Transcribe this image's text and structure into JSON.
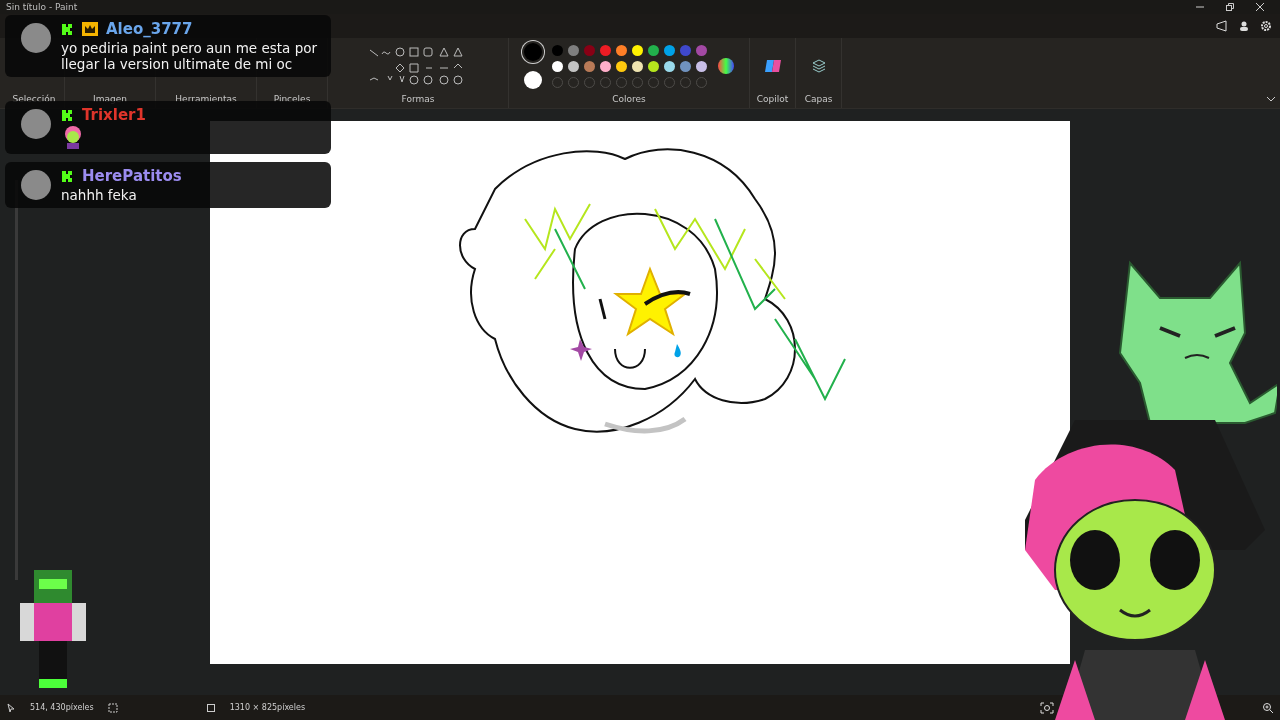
{
  "window": {
    "title": "Sin título - Paint"
  },
  "ribbon": {
    "groups": [
      "Selección",
      "Imagen",
      "Herramientas",
      "Pinceles",
      "Formas",
      "Colores",
      "Copilot",
      "Capas"
    ]
  },
  "current_colors": [
    {
      "color": "#000000",
      "selected": true
    },
    {
      "color": "#ffffff",
      "selected": false
    }
  ],
  "palette": [
    [
      {
        "color": "#000000"
      },
      {
        "color": "#7f7f7f"
      },
      {
        "color": "#880015"
      },
      {
        "color": "#ed1c24"
      },
      {
        "color": "#ff7f27"
      },
      {
        "color": "#fff200"
      },
      {
        "color": "#22b14c"
      },
      {
        "color": "#00a2e8"
      },
      {
        "color": "#3f48cc"
      },
      {
        "color": "#a349a4"
      }
    ],
    [
      {
        "color": "#ffffff"
      },
      {
        "color": "#c3c3c3"
      },
      {
        "color": "#b97a57"
      },
      {
        "color": "#ffaec9"
      },
      {
        "color": "#ffc90e"
      },
      {
        "color": "#efe4b0"
      },
      {
        "color": "#b5e61d"
      },
      {
        "color": "#99d9ea"
      },
      {
        "color": "#7092be"
      },
      {
        "color": "#c8bfe7"
      }
    ]
  ],
  "chat": [
    {
      "user": "Aleo_3777",
      "color": "#6aa6ec",
      "badges": [
        {
          "kind": "kick"
        },
        {
          "kind": "crown"
        }
      ],
      "kind": "text",
      "text": "yo pediria paint pero aun me esta por llegar la version ultimate de mi oc"
    },
    {
      "user": "Trixler1",
      "color": "#e0352b",
      "badges": [
        {
          "kind": "kick"
        }
      ],
      "kind": "emote"
    },
    {
      "user": "HerePatitos",
      "color": "#9b8cf0",
      "badges": [
        {
          "kind": "kick"
        }
      ],
      "kind": "text",
      "text": "nahhh feka"
    }
  ],
  "status_bar": {
    "cursor": "514, 430píxeles",
    "canvas_size": "1310 × 825píxeles"
  }
}
